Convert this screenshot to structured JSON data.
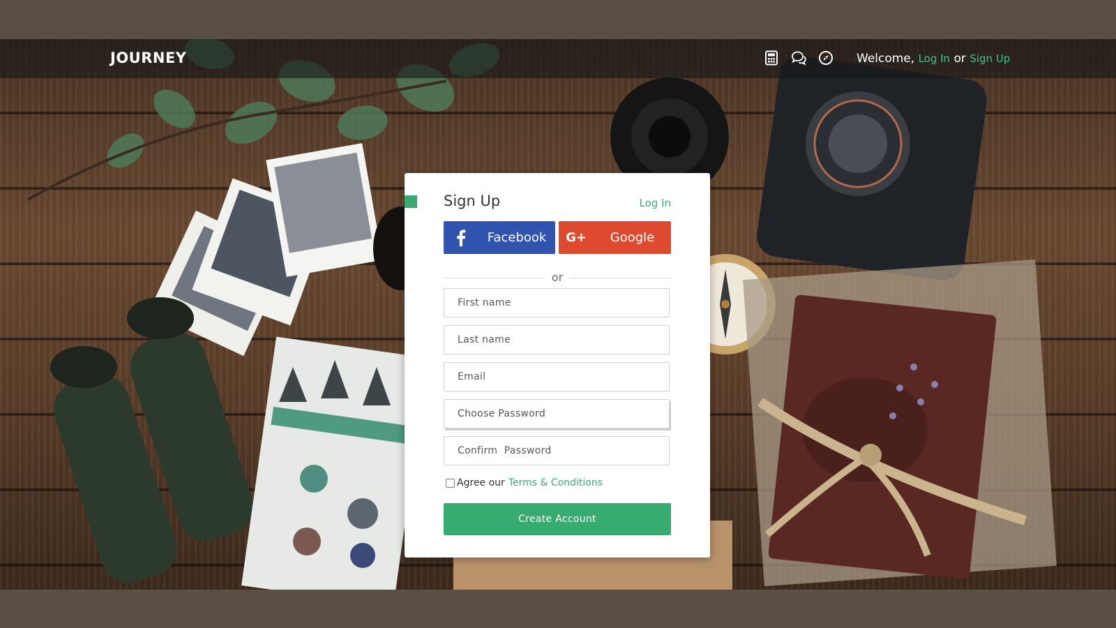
{
  "header": {
    "brand": "JOURNEY",
    "icons": [
      "calculator-icon",
      "chat-icon",
      "compass-icon"
    ],
    "welcome_text": "Welcome,",
    "login_link": "Log In",
    "or_text": "or",
    "signup_link": "Sign Up"
  },
  "card": {
    "title": "Sign Up",
    "login_link": "Log In",
    "facebook_label": "Facebook",
    "google_label": "Google",
    "google_icon_text": "G+",
    "divider_text": "or",
    "fields": {
      "first_name": "First name",
      "last_name": "Last name",
      "email": "Email",
      "password": "Choose Password",
      "confirm_password": "Confirm  Password"
    },
    "agree_text": "Agree our",
    "terms_link": "Terms & Conditions",
    "create_button": "Create Account"
  },
  "colors": {
    "accent": "#3aaa72",
    "facebook": "#3053ad",
    "google": "#de4a2f",
    "frame": "#594f47"
  }
}
